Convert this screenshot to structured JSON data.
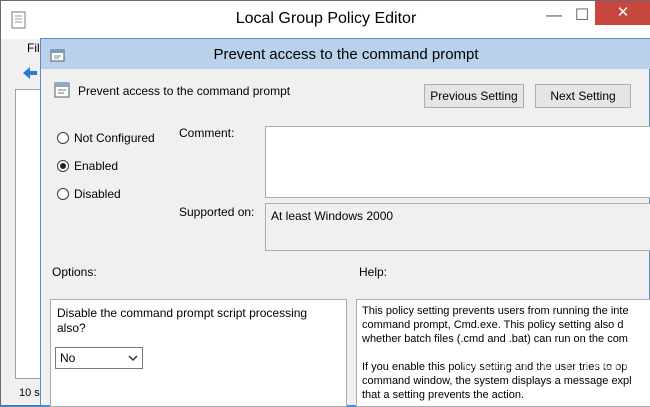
{
  "parent_window": {
    "title": "Local Group Policy Editor",
    "menu_partial": "File",
    "status_partial": "10 se",
    "controls": {
      "minimize": "—",
      "maximize": "☐",
      "close": "✕"
    }
  },
  "dialog": {
    "title": "Prevent access to the command prompt",
    "policy_name": "Prevent access to the command prompt",
    "previous_setting": "Previous Setting",
    "next_setting": "Next Setting",
    "radios": [
      {
        "label": "Not Configured",
        "selected": false
      },
      {
        "label": "Enabled",
        "selected": true
      },
      {
        "label": "Disabled",
        "selected": false
      }
    ],
    "comment_label": "Comment:",
    "supported_on_label": "Supported on:",
    "supported_on_value": "At least Windows 2000",
    "options_label": "Options:",
    "help_label": "Help:",
    "option_text": "Disable the command prompt script processing also?",
    "option_select_value": "No",
    "help_lines": [
      "This policy setting prevents users from running the inte",
      "command prompt, Cmd.exe.  This policy setting also d",
      "whether batch files (.cmd and .bat) can run on the com",
      "",
      "If you enable this policy setting and the user tries to op",
      "command window, the system displays a message expl",
      "that a setting prevents the action."
    ]
  },
  "watermark": "quantrimang",
  "colors": {
    "dialog_title_bg": "#b9d1ea",
    "close_button": "#c7463d",
    "desktop": "#3f8ed8"
  }
}
